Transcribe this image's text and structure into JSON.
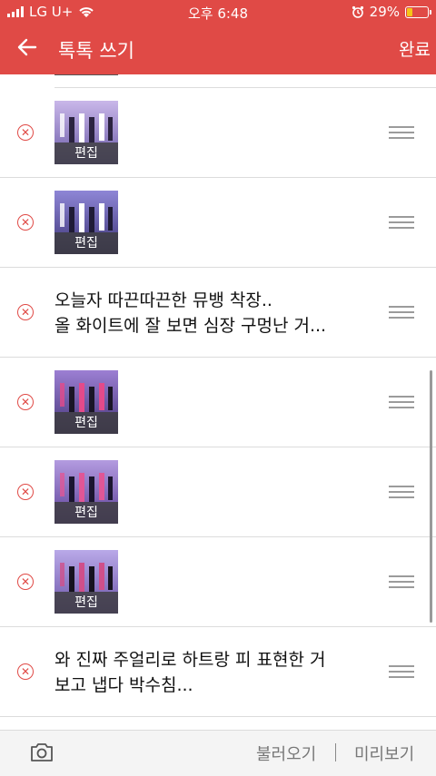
{
  "status_bar": {
    "carrier": "LG U+",
    "time": "오후 6:48",
    "battery_percent": "29%"
  },
  "header": {
    "title": "톡톡 쓰기",
    "done_label": "완료"
  },
  "rows": [
    {
      "type": "image",
      "edit_label": "편집",
      "palette": [
        "#c9b7e9",
        "#6a5aa8",
        "#ffffff",
        "#2b2340"
      ]
    },
    {
      "type": "image",
      "edit_label": "편집",
      "palette": [
        "#8e86d6",
        "#3d3478",
        "#ffffff",
        "#1f1b36"
      ]
    },
    {
      "type": "text",
      "line1": "오늘자 따끈따끈한 뮤뱅 착장..",
      "line2": "올 화이트에 잘 보면 심장 구멍난 거..."
    },
    {
      "type": "image",
      "edit_label": "편집",
      "palette": [
        "#9c7fd3",
        "#443579",
        "#e44a8a",
        "#1a1526"
      ]
    },
    {
      "type": "image",
      "edit_label": "편집",
      "palette": [
        "#b39be0",
        "#5b3f98",
        "#e05696",
        "#1b1530"
      ]
    },
    {
      "type": "image",
      "edit_label": "편집",
      "palette": [
        "#b9a9e8",
        "#6a53a8",
        "#cf4f8a",
        "#16121f"
      ]
    },
    {
      "type": "text",
      "line1": "와 진짜 주얼리로 하트랑 피 표현한 거",
      "line2": "보고 냅다 박수침..."
    }
  ],
  "footer": {
    "load_label": "불러오기",
    "separator": "|",
    "preview_label": "미리보기"
  },
  "colors": {
    "brand": "#e04a46",
    "battery_fill": "#f5c518"
  }
}
